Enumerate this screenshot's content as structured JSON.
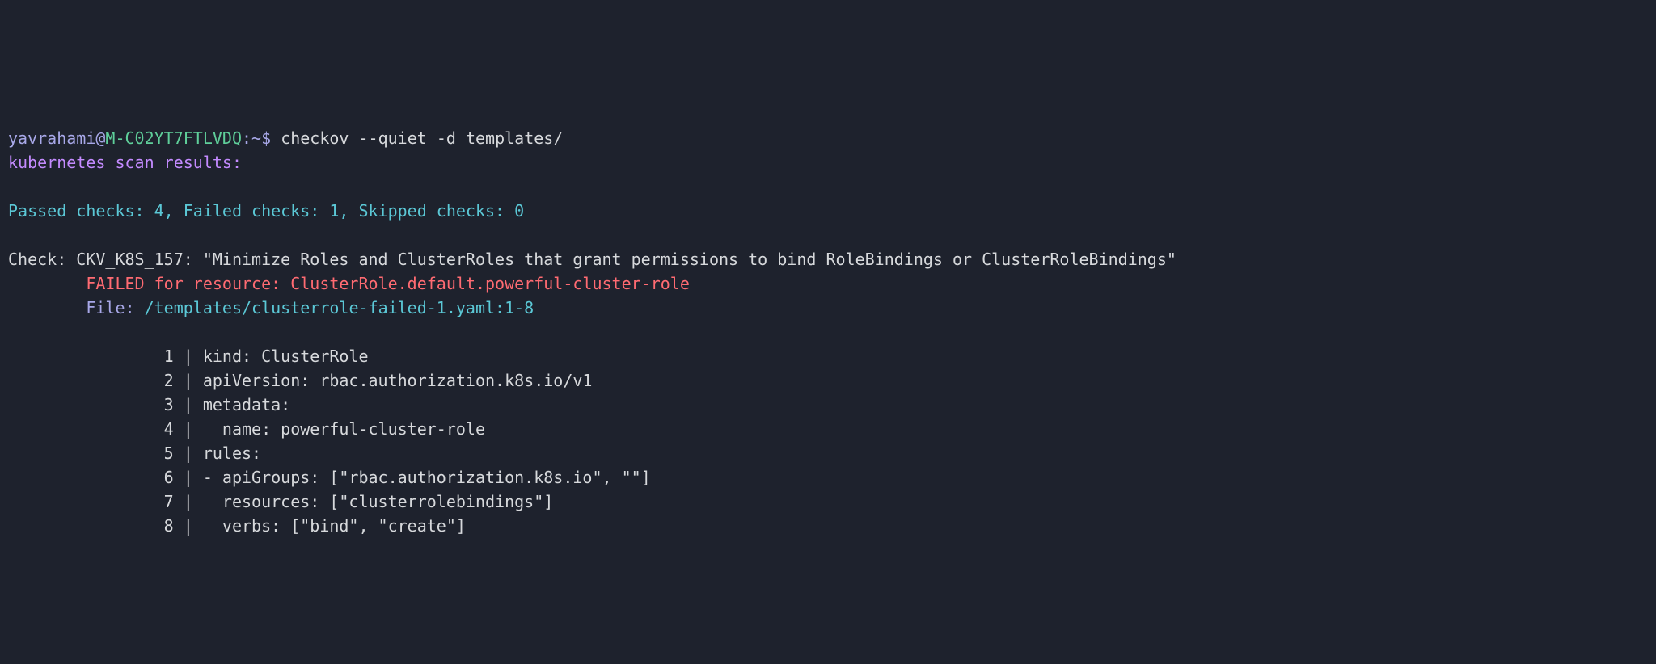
{
  "prompt": {
    "user": "yavrahami",
    "at": "@",
    "host": "M-C02YT7FTLVDQ",
    "colon": ":",
    "path": "~",
    "dollar": "$ ",
    "command": "checkov --quiet -d templates/"
  },
  "heading": "kubernetes scan results:",
  "summary": "Passed checks: 4, Failed checks: 1, Skipped checks: 0",
  "check": {
    "line": "Check: CKV_K8S_157: \"Minimize Roles and ClusterRoles that grant permissions to bind RoleBindings or ClusterRoleBindings\"",
    "failed": "\tFAILED for resource: ClusterRole.default.powerful-cluster-role",
    "file_label": "\tFile: ",
    "file_value": "/templates/clusterrole-failed-1.yaml:1-8"
  },
  "code": {
    "l1": "\t\t1 | kind: ClusterRole",
    "l2": "\t\t2 | apiVersion: rbac.authorization.k8s.io/v1",
    "l3": "\t\t3 | metadata:",
    "l4": "\t\t4 |   name: powerful-cluster-role",
    "l5": "\t\t5 | rules:",
    "l6": "\t\t6 | - apiGroups: [\"rbac.authorization.k8s.io\", \"\"]",
    "l7": "\t\t7 |   resources: [\"clusterrolebindings\"]",
    "l8": "\t\t8 |   verbs: [\"bind\", \"create\"]"
  },
  "chart_data": {
    "type": "table",
    "title": "kubernetes scan results",
    "summary": {
      "passed": 4,
      "failed": 1,
      "skipped": 0
    },
    "check_id": "CKV_K8S_157",
    "check_description": "Minimize Roles and ClusterRoles that grant permissions to bind RoleBindings or ClusterRoleBindings",
    "status": "FAILED",
    "resource": "ClusterRole.default.powerful-cluster-role",
    "file": "/templates/clusterrole-failed-1.yaml",
    "line_range": "1-8",
    "source_lines": [
      "kind: ClusterRole",
      "apiVersion: rbac.authorization.k8s.io/v1",
      "metadata:",
      "  name: powerful-cluster-role",
      "rules:",
      "- apiGroups: [\"rbac.authorization.k8s.io\", \"\"]",
      "  resources: [\"clusterrolebindings\"]",
      "  verbs: [\"bind\", \"create\"]"
    ]
  }
}
